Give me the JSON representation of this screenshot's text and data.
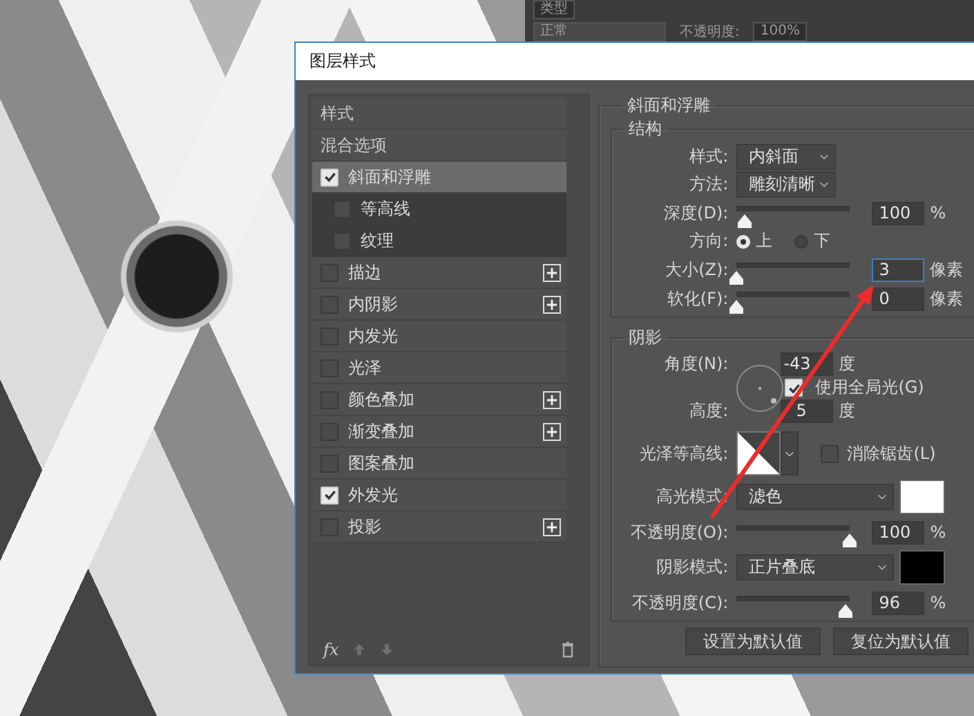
{
  "app_panel": {
    "search": "类型",
    "blend_mode": "正常",
    "opacity_label": "不透明度:",
    "opacity_value": "100%"
  },
  "window": {
    "title": "图层样式"
  },
  "styles": [
    {
      "kind": "header",
      "label": "样式",
      "selected": false
    },
    {
      "kind": "header",
      "label": "混合选项",
      "selected": false
    },
    {
      "kind": "check",
      "label": "斜面和浮雕",
      "checked": true,
      "selected": true,
      "add_button": false,
      "children": [
        {
          "kind": "check",
          "label": "等高线",
          "checked": false,
          "selected": false,
          "add_button": false
        },
        {
          "kind": "check",
          "label": "纹理",
          "checked": false,
          "selected": false,
          "add_button": false
        }
      ]
    },
    {
      "kind": "check",
      "label": "描边",
      "checked": false,
      "selected": false,
      "add_button": true
    },
    {
      "kind": "check",
      "label": "内阴影",
      "checked": false,
      "selected": false,
      "add_button": true
    },
    {
      "kind": "check",
      "label": "内发光",
      "checked": false,
      "selected": false,
      "add_button": false
    },
    {
      "kind": "check",
      "label": "光泽",
      "checked": false,
      "selected": false,
      "add_button": false
    },
    {
      "kind": "check",
      "label": "颜色叠加",
      "checked": false,
      "selected": false,
      "add_button": true
    },
    {
      "kind": "check",
      "label": "渐变叠加",
      "checked": false,
      "selected": false,
      "add_button": true
    },
    {
      "kind": "check",
      "label": "图案叠加",
      "checked": false,
      "selected": false,
      "add_button": false
    },
    {
      "kind": "check",
      "label": "外发光",
      "checked": true,
      "selected": false,
      "add_button": false
    },
    {
      "kind": "check",
      "label": "投影",
      "checked": false,
      "selected": false,
      "add_button": true
    }
  ],
  "list_footer": {
    "fx": "fx"
  },
  "bevel": {
    "title": "斜面和浮雕",
    "structure": {
      "title": "结构",
      "style": {
        "label": "样式:",
        "value": "内斜面"
      },
      "technique": {
        "label": "方法:",
        "value": "雕刻清晰"
      },
      "depth": {
        "label": "深度(D):",
        "level": 0.07,
        "value": "100",
        "unit": "%",
        "focused": false
      },
      "direction": {
        "label": "方向:",
        "options": [
          {
            "label": "上",
            "selected": true
          },
          {
            "label": "下",
            "selected": false
          }
        ]
      },
      "size": {
        "label": "大小(Z):",
        "level": 0.0,
        "value": "3",
        "unit": "像素",
        "focused": true
      },
      "soften": {
        "label": "软化(F):",
        "level": 0.0,
        "value": "0",
        "unit": "像素",
        "focused": false
      }
    },
    "shading": {
      "title": "阴影",
      "angle": {
        "label": "角度(N):",
        "value": "-43",
        "unit": "度"
      },
      "global_light": {
        "label": "使用全局光(G)",
        "checked": true
      },
      "altitude": {
        "label": "高度:",
        "value": "5",
        "unit": "度"
      },
      "gloss_contour": {
        "label": "光泽等高线:"
      },
      "anti_aliased": {
        "label": "消除锯齿(L)",
        "checked": false
      },
      "highlight_mode": {
        "label": "高光模式:",
        "value": "滤色",
        "color": "#ffffff"
      },
      "highlight_opacity": {
        "label": "不透明度(O):",
        "level": 1.0,
        "value": "100",
        "unit": "%",
        "focused": false
      },
      "shadow_mode": {
        "label": "阴影模式:",
        "value": "正片叠底",
        "color": "#000000"
      },
      "shadow_opacity": {
        "label": "不透明度(C):",
        "level": 0.96,
        "value": "96",
        "unit": "%",
        "focused": false
      }
    }
  },
  "buttons": [
    {
      "label": "设置为默认值"
    },
    {
      "label": "复位为默认值"
    }
  ]
}
